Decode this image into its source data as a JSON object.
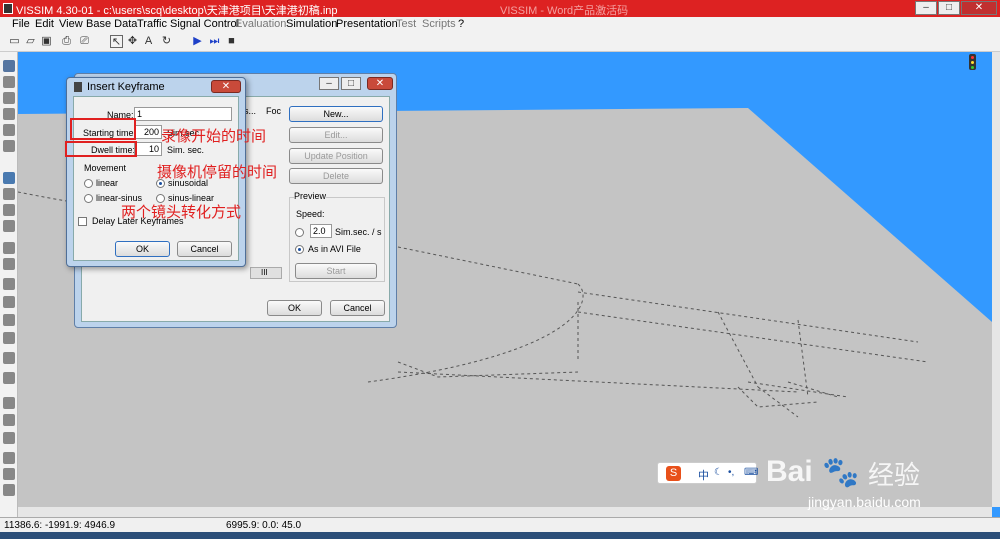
{
  "window": {
    "title": "VISSIM 4.30-01 - c:\\users\\scq\\desktop\\天津港项目\\天津港初稿.inp",
    "title_right_faded": "VISSIM - Word产品激活码"
  },
  "menu": [
    "File",
    "Edit",
    "View",
    "Base Data",
    "Traffic",
    "Signal Control",
    "Evaluation",
    "Simulation",
    "Presentation",
    "Test",
    "Scripts",
    "?"
  ],
  "toolbar_icons": [
    "new-icon",
    "open-icon",
    "save-icon",
    "preview-icon",
    "print-icon",
    "select-icon",
    "move-icon",
    "zoom-text-icon",
    "rotate-icon",
    "play-icon",
    "step-icon",
    "stop-icon"
  ],
  "back_dialog": {
    "tab_partial": "s...",
    "tab2_partial": "Foc",
    "new_button": "New...",
    "edit_button": "Edit...",
    "update_position_button": "Update Position",
    "delete_button": "Delete",
    "preview_group": "Preview",
    "speed_label": "Speed:",
    "speed_value": "2.0",
    "speed_unit": "Sim.sec. / s",
    "avi_label": "As in AVI File",
    "start_button": "Start",
    "ok_button": "OK",
    "cancel_button": "Cancel",
    "scrollbar_mark": "III"
  },
  "insert_keyframe": {
    "title": "Insert Keyframe",
    "name_label": "Name:",
    "name_value": "1",
    "starting_time_label": "Starting time:",
    "starting_time_value": "200",
    "starting_time_unit": "Sim.sec.",
    "dwell_time_label": "Dwell time:",
    "dwell_time_value": "10",
    "dwell_time_unit": "Sim. sec.",
    "movement_label": "Movement",
    "opt_linear": "linear",
    "opt_sinusoidal": "sinusoidal",
    "opt_linear_sinus": "linear-sinus",
    "opt_sinus_linear": "sinus-linear",
    "delay_label": "Delay Later Keyframes",
    "ok_button": "OK",
    "cancel_button": "Cancel"
  },
  "annotations": {
    "a1": "录像开始的时间",
    "a2": "摄像机停留的时间",
    "a3": "两个镜头转化方式"
  },
  "status": {
    "coords_left": "11386.6: -1991.9: 4946.9",
    "coords_mid": "6995.9: 0.0: 45.0"
  },
  "watermark": {
    "brand": "Bai",
    "brand2": "经验",
    "url": "jingyan.baidu.com"
  },
  "ime": {
    "label": "中"
  },
  "colors": {
    "sky": "#3399ff",
    "ground": "#c4c4c4",
    "title_bar": "#dd2222",
    "annotation": "#e02020"
  }
}
